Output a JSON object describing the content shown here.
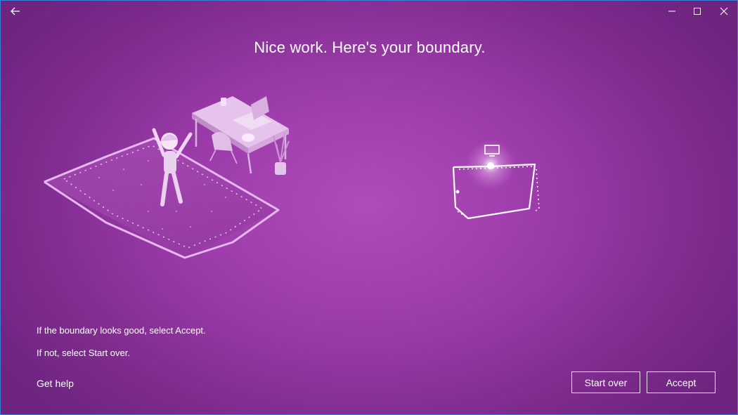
{
  "window": {
    "back_icon": "arrow-left-icon",
    "minimize_icon": "minimize-icon",
    "maximize_icon": "maximize-icon",
    "close_icon": "close-icon"
  },
  "main": {
    "heading": "Nice work. Here's your boundary.",
    "instruction_accept": "If the boundary looks good, select Accept.",
    "instruction_start_over": "If not, select Start over."
  },
  "footer": {
    "get_help": "Get help",
    "start_over": "Start over",
    "accept": "Accept"
  },
  "theme": {
    "background": "#9a3aa8",
    "accent_border": "#3d7fd6"
  }
}
